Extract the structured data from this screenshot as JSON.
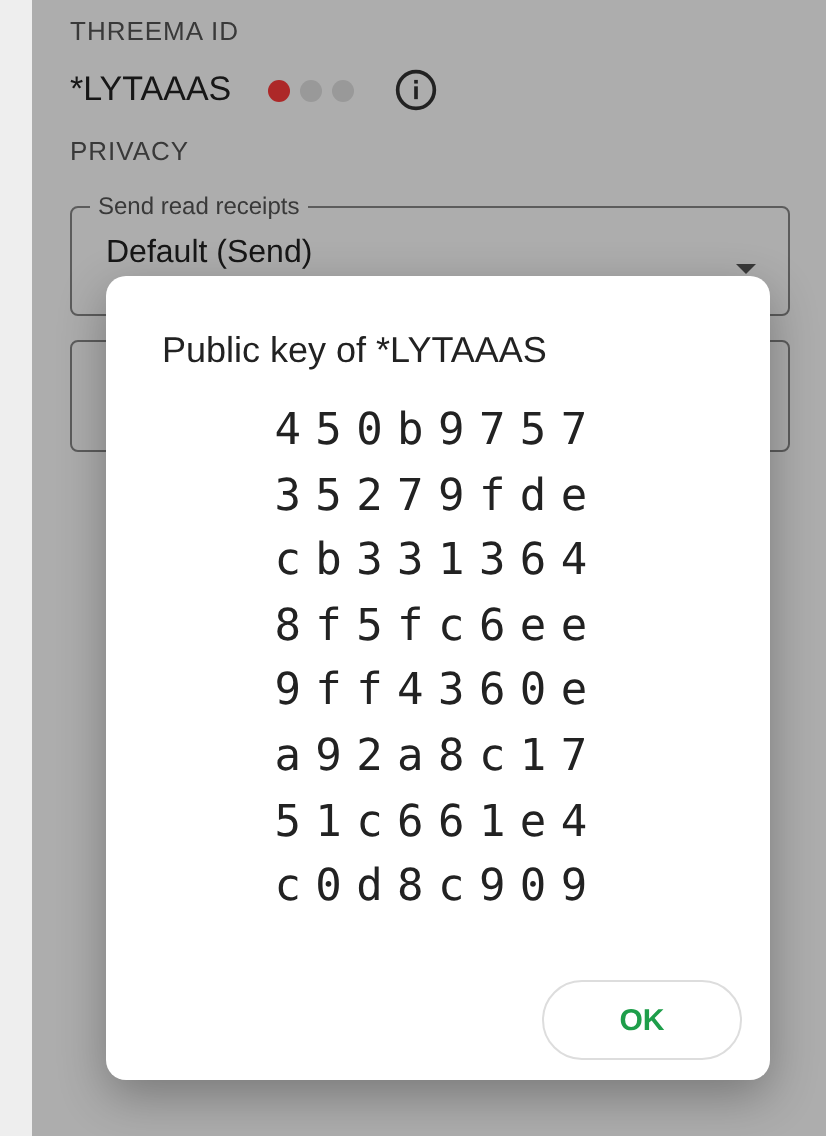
{
  "threema_id": {
    "label": "THREEMA ID",
    "id": "*LYTAAAS",
    "verification_dots": [
      {
        "on": true
      },
      {
        "on": false
      },
      {
        "on": false
      }
    ]
  },
  "privacy": {
    "label": "PRIVACY",
    "read_receipts": {
      "label": "Send read receipts",
      "value": "Default (Send)"
    }
  },
  "dialog": {
    "title": "Public key of *LYTAAAS",
    "key_lines": [
      "450b9757",
      "35279fde",
      "cb331364",
      "8f5fc6ee",
      "9ff4360e",
      "a92a8c17",
      "51c661e4",
      "c0d8c909"
    ],
    "button": "OK"
  }
}
